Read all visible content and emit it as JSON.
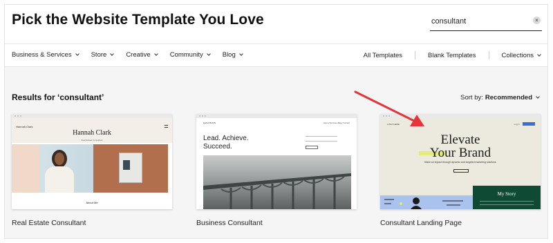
{
  "header": {
    "title": "Pick the Website Template You Love"
  },
  "search": {
    "value": "consultant",
    "clear_icon": "×"
  },
  "nav": {
    "left": [
      "Business & Services",
      "Store",
      "Creative",
      "Community",
      "Blog"
    ],
    "right": [
      "All Templates",
      "Blank Templates",
      "Collections"
    ]
  },
  "results": {
    "title": "Results for ‘consultant’"
  },
  "sort": {
    "prefix": "Sort by:",
    "value": "Recommended"
  },
  "cards": [
    {
      "label": "Real Estate Consultant",
      "preview": {
        "brand": "Hannah Clark",
        "heading": "Hannah Clark",
        "subheading": "Real Estate Consultant",
        "footer": "About Me"
      }
    },
    {
      "label": "Business Consultant",
      "preview": {
        "brand": "LEAH MOON",
        "heading_line1": "Lead. Achieve.",
        "heading_line2": "Succeed.",
        "links": "Home  Services  Blog  Contact"
      }
    },
    {
      "label": "Consultant Landing Page",
      "preview": {
        "brand": "LOGO HERE",
        "login": "Log In",
        "heading_line1": "Elevate",
        "heading_line2": "Your Brand",
        "sub": "Make an impact through dynamic and targeted marketing solutions",
        "story_title": "My Story"
      }
    }
  ],
  "colors": {
    "accent_arrow": "#e6343b",
    "cta_blue": "#3b6dd8",
    "story_green": "#0f4a35",
    "brown_panel": "#b26f4d"
  }
}
